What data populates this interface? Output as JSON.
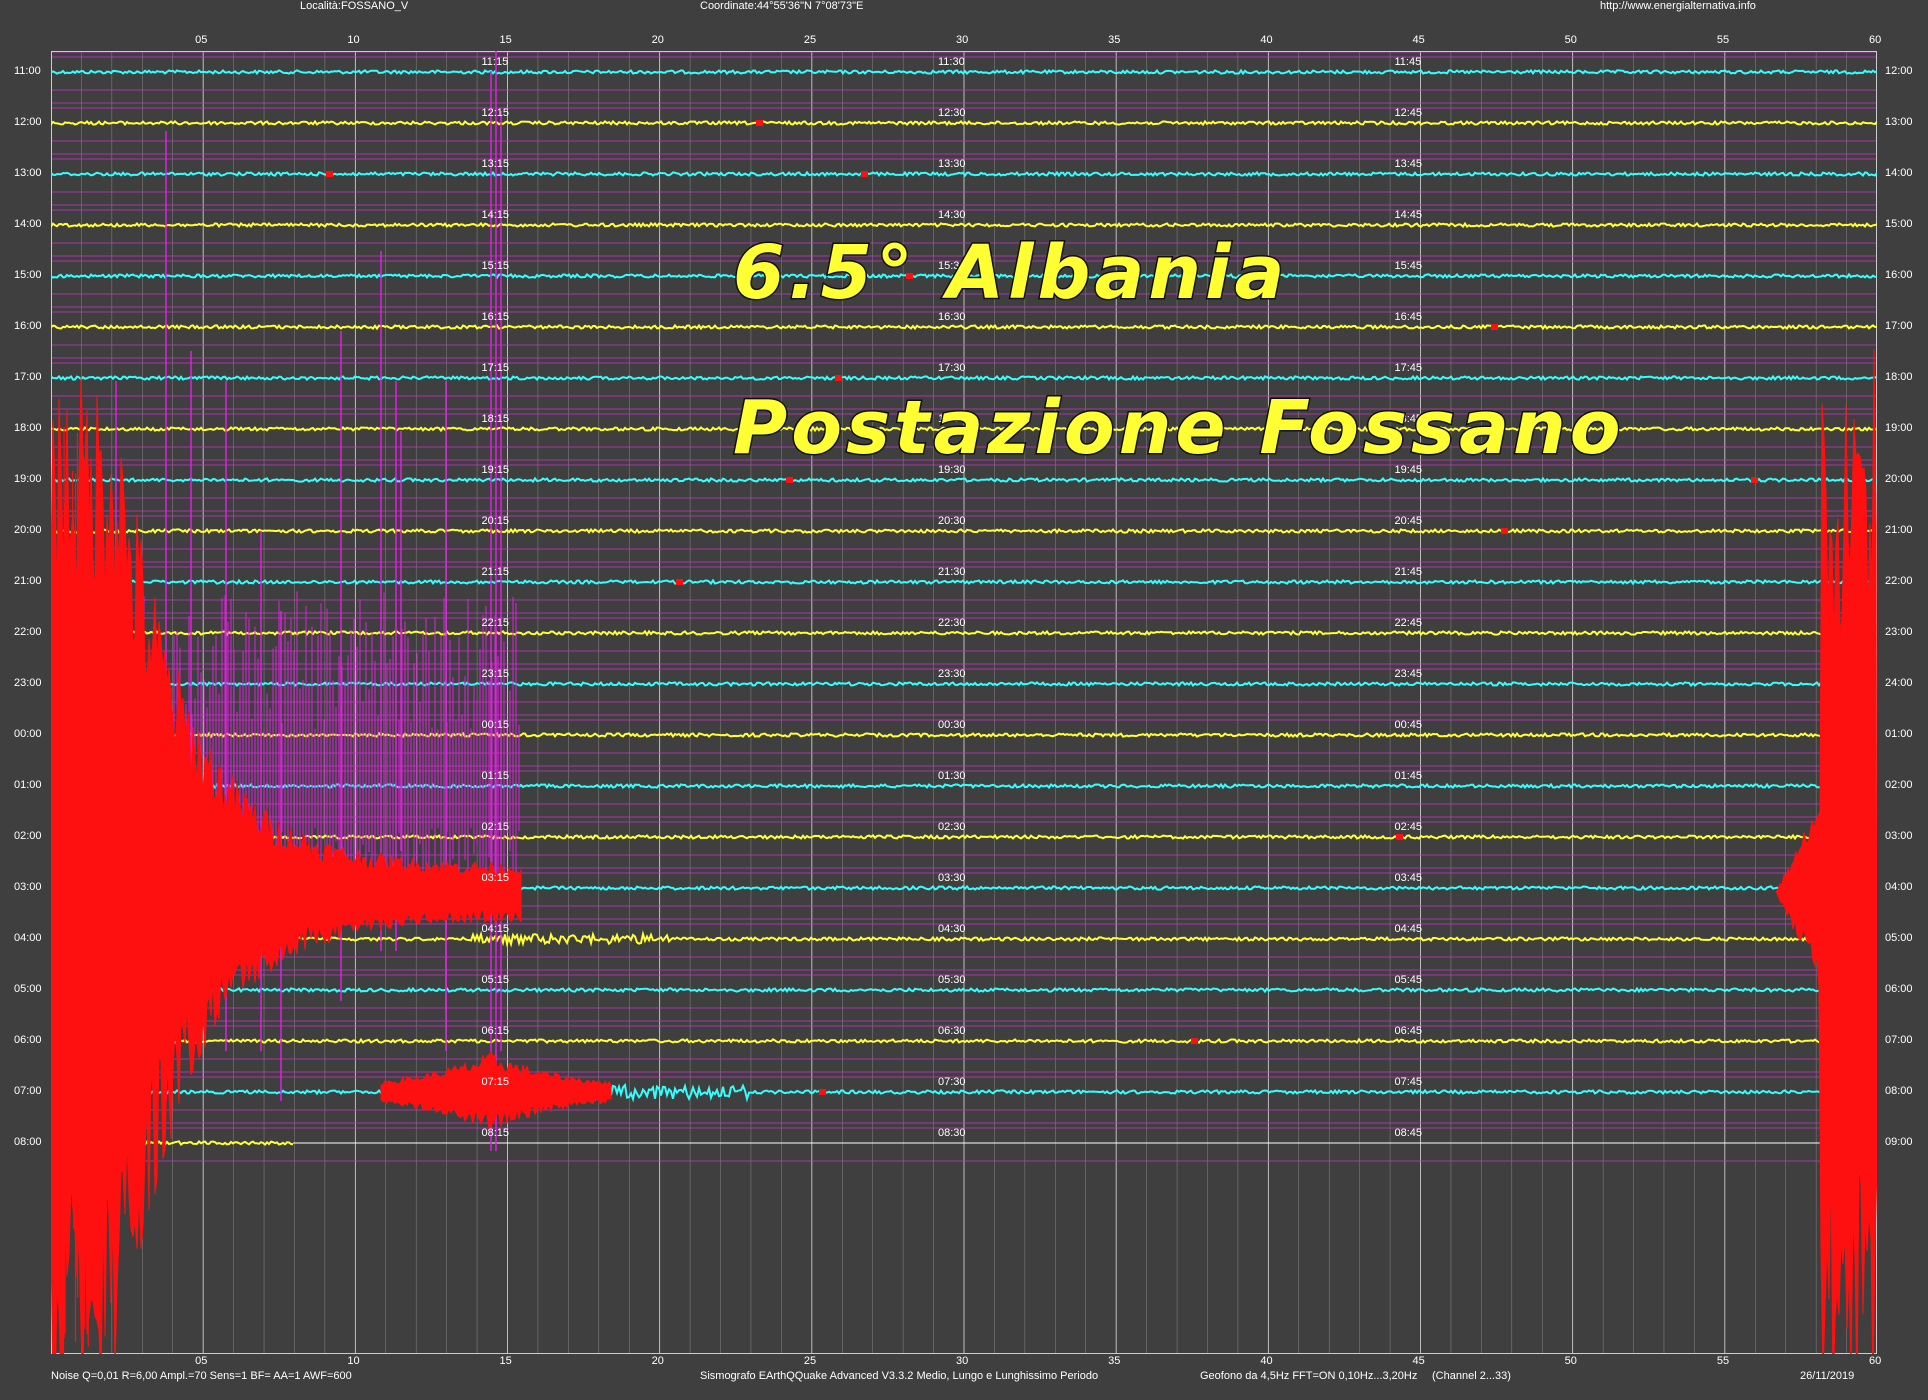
{
  "header": {
    "location": "Località:FOSSANO_V",
    "coordinates": "Coordinate:44°55'36\"N 7°08'73\"E",
    "url": "http://www.energialternativa.info"
  },
  "minute_ticks": [
    "05",
    "10",
    "15",
    "20",
    "25",
    "30",
    "35",
    "40",
    "45",
    "50",
    "55",
    "60"
  ],
  "rows": [
    {
      "left": "11:00",
      "right": "12:00",
      "m15": "11:15",
      "m30": "11:30",
      "m45": "11:45",
      "color": "#33ffff"
    },
    {
      "left": "12:00",
      "right": "13:00",
      "m15": "12:15",
      "m30": "12:30",
      "m45": "12:45",
      "color": "#ffff33"
    },
    {
      "left": "13:00",
      "right": "14:00",
      "m15": "13:15",
      "m30": "13:30",
      "m45": "13:45",
      "color": "#33ffff"
    },
    {
      "left": "14:00",
      "right": "15:00",
      "m15": "14:15",
      "m30": "14:30",
      "m45": "14:45",
      "color": "#ffff33"
    },
    {
      "left": "15:00",
      "right": "16:00",
      "m15": "15:15",
      "m30": "15:30",
      "m45": "15:45",
      "color": "#33ffff"
    },
    {
      "left": "16:00",
      "right": "17:00",
      "m15": "16:15",
      "m30": "16:30",
      "m45": "16:45",
      "color": "#ffff33"
    },
    {
      "left": "17:00",
      "right": "18:00",
      "m15": "17:15",
      "m30": "17:30",
      "m45": "17:45",
      "color": "#33ffff"
    },
    {
      "left": "18:00",
      "right": "19:00",
      "m15": "18:15",
      "m30": "18:30",
      "m45": "18:45",
      "color": "#ffff33"
    },
    {
      "left": "19:00",
      "right": "20:00",
      "m15": "19:15",
      "m30": "19:30",
      "m45": "19:45",
      "color": "#33ffff"
    },
    {
      "left": "20:00",
      "right": "21:00",
      "m15": "20:15",
      "m30": "20:30",
      "m45": "20:45",
      "color": "#ffff33"
    },
    {
      "left": "21:00",
      "right": "22:00",
      "m15": "21:15",
      "m30": "21:30",
      "m45": "21:45",
      "color": "#33ffff"
    },
    {
      "left": "22:00",
      "right": "23:00",
      "m15": "22:15",
      "m30": "22:30",
      "m45": "22:45",
      "color": "#ffff33"
    },
    {
      "left": "23:00",
      "right": "24:00",
      "m15": "23:15",
      "m30": "23:30",
      "m45": "23:45",
      "color": "#33ffff"
    },
    {
      "left": "00:00",
      "right": "01:00",
      "m15": "00:15",
      "m30": "00:30",
      "m45": "00:45",
      "color": "#ffff33"
    },
    {
      "left": "01:00",
      "right": "02:00",
      "m15": "01:15",
      "m30": "01:30",
      "m45": "01:45",
      "color": "#33ffff"
    },
    {
      "left": "02:00",
      "right": "03:00",
      "m15": "02:15",
      "m30": "02:30",
      "m45": "02:45",
      "color": "#ffff33"
    },
    {
      "left": "03:00",
      "right": "04:00",
      "m15": "03:15",
      "m30": "03:30",
      "m45": "03:45",
      "color": "#33ffff"
    },
    {
      "left": "04:00",
      "right": "05:00",
      "m15": "04:15",
      "m30": "04:30",
      "m45": "04:45",
      "color": "#ffff33"
    },
    {
      "left": "05:00",
      "right": "06:00",
      "m15": "05:15",
      "m30": "05:30",
      "m45": "05:45",
      "color": "#33ffff"
    },
    {
      "left": "06:00",
      "right": "07:00",
      "m15": "06:15",
      "m30": "06:30",
      "m45": "06:45",
      "color": "#ffff33"
    },
    {
      "left": "07:00",
      "right": "08:00",
      "m15": "07:15",
      "m30": "07:30",
      "m45": "07:45",
      "color": "#33ffff"
    },
    {
      "left": "08:00",
      "right": "09:00",
      "m15": "08:15",
      "m30": "08:30",
      "m45": "08:45",
      "color": "#ffff33"
    }
  ],
  "overlay": {
    "line1": "6.5° Albania",
    "line2": "Postazione Fossano"
  },
  "footer": {
    "params": "Noise Q=0,01 R=6,00 Ampl.=70 Sens=1 BF= AA=1 AWF=600",
    "software": "Sismografo  EArthQQuake Advanced V3.3.2  Medio, Lungo e Lunghissimo Periodo",
    "geofono": "Geofono da 4,5Hz FFT=ON 0,10Hz...3,20Hz",
    "channel": "(Channel 2...33)",
    "date": "26/11/2019"
  },
  "colors": {
    "background": "#3f3f3f",
    "grid_magenta": "#cc33cc",
    "trace_cyan": "#33ffff",
    "trace_yellow": "#ffff33",
    "quake_red": "#ff1010",
    "quake_magenta": "#dd22dd"
  }
}
